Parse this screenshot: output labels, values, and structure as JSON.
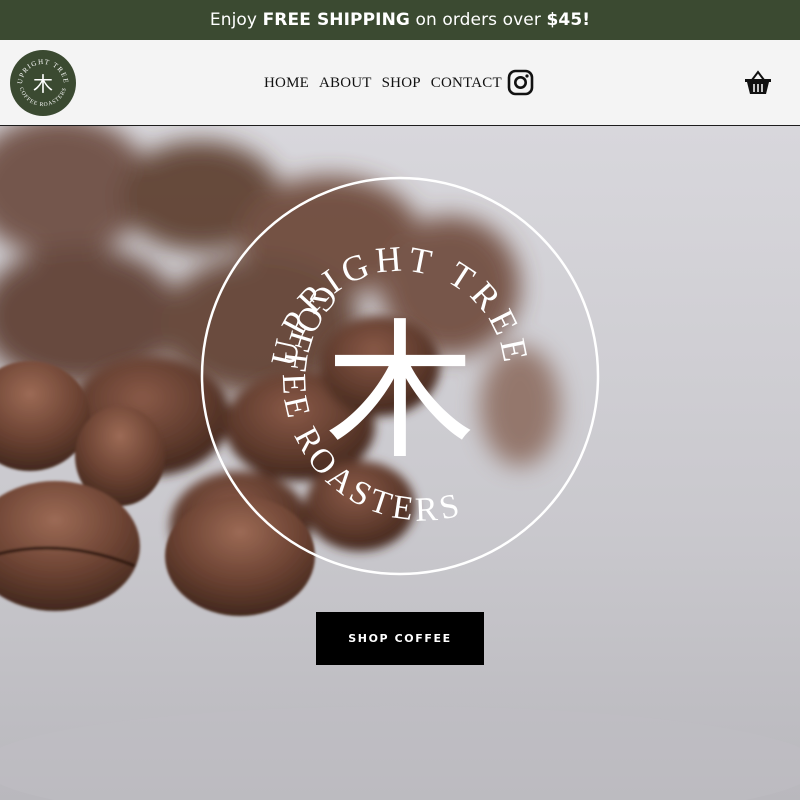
{
  "announcement": {
    "prefix": "Enjoy ",
    "highlight": "FREE SHIPPING",
    "middle": " on orders over ",
    "amount": "$45!"
  },
  "brand": {
    "name_top": "UPRIGHT TREE",
    "name_bottom": "COFFEE ROASTERS",
    "symbol": "木",
    "badge_color": "#3b4a31"
  },
  "nav": {
    "items": [
      {
        "label": "HOME"
      },
      {
        "label": "ABOUT"
      },
      {
        "label": "SHOP"
      },
      {
        "label": "CONTACT"
      }
    ],
    "social_icon": "instagram-icon",
    "cart_icon": "basket-icon"
  },
  "hero": {
    "emblem_top": "UPRIGHT TREE",
    "emblem_bottom": "COFFEE ROASTERS",
    "emblem_symbol": "木",
    "cta_label": "SHOP COFFEE"
  },
  "colors": {
    "announce_bg": "#3b4a31",
    "header_bg": "#f4f4f4",
    "cta_bg": "#000000"
  }
}
